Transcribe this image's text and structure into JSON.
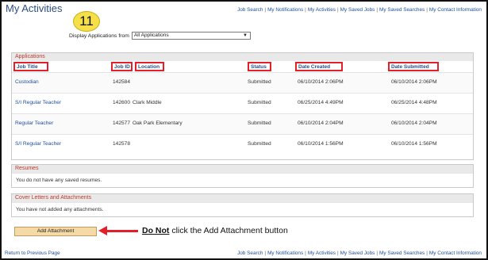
{
  "page": {
    "title": "My Activities",
    "step_number": "11"
  },
  "nav": {
    "items": [
      "Job Search",
      "My Notifications",
      "My Activities",
      "My Saved Jobs",
      "My Saved Searches",
      "My Contact Information"
    ],
    "separator": "|"
  },
  "filter": {
    "label": "Display Applications from",
    "selected": "All Applications"
  },
  "applications": {
    "header": "Applications",
    "columns": {
      "job_title": "Job Title",
      "job_id": "Job ID",
      "location": "Location",
      "status": "Status",
      "date_created": "Date Created",
      "date_submitted": "Date Submitted"
    },
    "rows": [
      {
        "job_title": "Custodian",
        "job_id": "142584",
        "location": "",
        "status": "Submitted",
        "date_created": "06/10/2014  2:06PM",
        "date_submitted": "06/10/2014  2:06PM"
      },
      {
        "job_title": "S/I Regular Teacher",
        "job_id": "142600",
        "location": "Clark Middle",
        "status": "Submitted",
        "date_created": "06/25/2014  4:49PM",
        "date_submitted": "06/25/2014  4:48PM"
      },
      {
        "job_title": "Regular Teacher",
        "job_id": "142577",
        "location": "Oak Park Elementary",
        "status": "Submitted",
        "date_created": "06/10/2014  2:04PM",
        "date_submitted": "06/10/2014  2:04PM"
      },
      {
        "job_title": "S/I Regular Teacher",
        "job_id": "142578",
        "location": "",
        "status": "Submitted",
        "date_created": "06/10/2014  1:56PM",
        "date_submitted": "06/10/2014  1:56PM"
      }
    ]
  },
  "resumes": {
    "header": "Resumes",
    "message": "You do not have any saved resumes."
  },
  "cover_letters": {
    "header": "Cover Letters and Attachments",
    "message": "You have not added any attachments."
  },
  "add_attachment_label": "Add Attachment",
  "callout": {
    "emphasis": "Do Not",
    "rest": " click the Add Attachment button"
  },
  "footer": {
    "back_link": "Return to Previous Page"
  },
  "colors": {
    "link": "#1d4fa0",
    "highlight_red": "#e3202a",
    "section_header_text": "#c0392b",
    "badge": "#f6e04a",
    "button": "#f5d9a6"
  },
  "icons": {
    "dropdown": "chevron-down-icon",
    "annotation_arrow": "arrow-left-icon"
  }
}
